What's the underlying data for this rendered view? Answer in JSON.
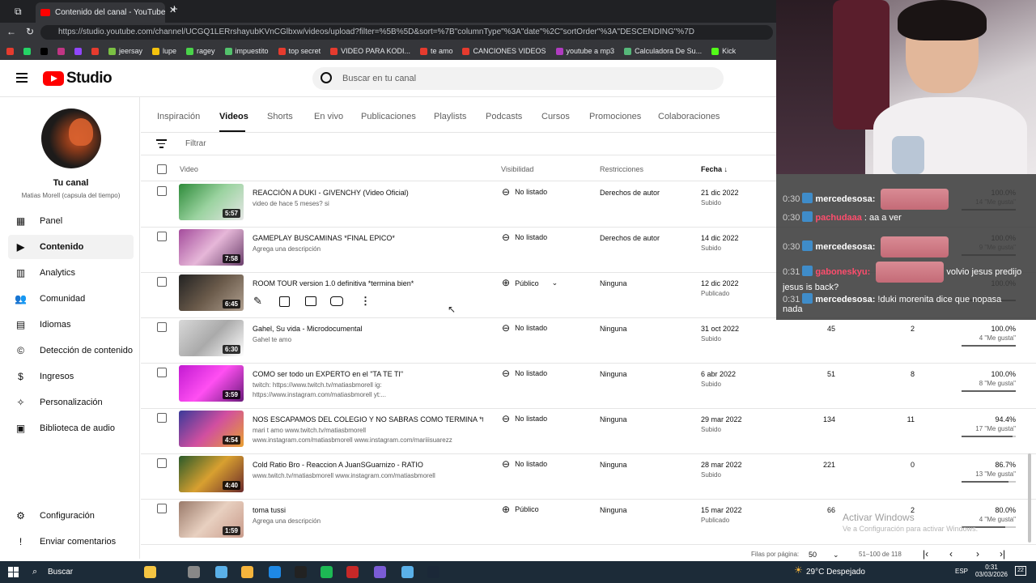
{
  "browser": {
    "tab_title": "Contenido del canal - YouTube St...",
    "url": "https://studio.youtube.com/channel/UCGQ1LERrshayubKVnCGlbxw/videos/upload?filter=%5B%5D&sort=%7B\"columnType\"%3A\"date\"%2C\"sortOrder\"%3A\"DESCENDING\"%7D",
    "bookmarks": [
      "jeersay",
      "lupe",
      "ragey",
      "impuestito",
      "top secret",
      "VIDEO PARA KODI...",
      "te amo",
      "CANCIONES VIDEOS",
      "youtube a mp3",
      "Calculadora De Su...",
      "Kick"
    ]
  },
  "header": {
    "logo_text": "Studio",
    "search_placeholder": "Buscar en tu canal"
  },
  "sidebar": {
    "channel_title": "Tu canal",
    "channel_name": "Matias Morell (capsula del tiempo)",
    "items": [
      {
        "label": "Panel",
        "icon": "dashboard-icon"
      },
      {
        "label": "Contenido",
        "icon": "content-icon"
      },
      {
        "label": "Analytics",
        "icon": "analytics-icon"
      },
      {
        "label": "Comunidad",
        "icon": "community-icon"
      },
      {
        "label": "Idiomas",
        "icon": "subtitles-icon"
      },
      {
        "label": "Detección de contenido",
        "icon": "copyright-icon"
      },
      {
        "label": "Ingresos",
        "icon": "earn-icon"
      },
      {
        "label": "Personalización",
        "icon": "magic-wand-icon"
      },
      {
        "label": "Biblioteca de audio",
        "icon": "audio-library-icon"
      }
    ],
    "bottom": [
      {
        "label": "Configuración",
        "icon": "gear-icon"
      },
      {
        "label": "Enviar comentarios",
        "icon": "feedback-icon"
      }
    ]
  },
  "content_tabs": [
    "Inspiración",
    "Videos",
    "Shorts",
    "En vivo",
    "Publicaciones",
    "Playlists",
    "Podcasts",
    "Cursos",
    "Promociones",
    "Colaboraciones"
  ],
  "filter_placeholder": "Filtrar",
  "columns": {
    "video": "Video",
    "visibility": "Visibilidad",
    "restrictions": "Restricciones",
    "date": "Fecha"
  },
  "rows": [
    {
      "title": "REACCIÓN A DUKI - GIVENCHY (Video Oficial)",
      "desc": "video de hace 5 meses? si",
      "desc2": "",
      "duration": "5:57",
      "visibility": "No listado",
      "restriction": "Derechos de autor",
      "date": "21 dic 2022",
      "status": "Subido",
      "views": "",
      "comments": "",
      "like_pct": "100.0%",
      "likes": "14 \"Me gusta\"",
      "like_frac": 1.0
    },
    {
      "title": "GAMEPLAY BUSCAMINAS *FINAL EPICO*",
      "desc": "Agrega una descripción",
      "desc2": "",
      "duration": "7:58",
      "visibility": "No listado",
      "restriction": "Derechos de autor",
      "date": "14 dic 2022",
      "status": "Subido",
      "views": "",
      "comments": "",
      "like_pct": "100.0%",
      "likes": "9 \"Me gusta\"",
      "like_frac": 1.0
    },
    {
      "title": "ROOM TOUR version 1.0 definitiva *termina bien*",
      "desc": "",
      "desc2": "",
      "duration": "6:45",
      "visibility": "Público",
      "restriction": "Ninguna",
      "date": "12 dic 2022",
      "status": "Publicado",
      "views": "",
      "comments": "",
      "like_pct": "100.0%",
      "likes": "",
      "like_frac": 1.0
    },
    {
      "title": "Gahel, Su vida - Microdocumental",
      "desc": "Gahel te amo",
      "desc2": "",
      "duration": "6:30",
      "visibility": "No listado",
      "restriction": "Ninguna",
      "date": "31 oct 2022",
      "status": "Subido",
      "views": "45",
      "comments": "2",
      "like_pct": "100.0%",
      "likes": "4 \"Me gusta\"",
      "like_frac": 1.0
    },
    {
      "title": "COMO ser todo un EXPERTO en el \"TA TE TI\"",
      "desc": "twitch: https://www.twitch.tv/matiasbmorell ig:",
      "desc2": "https://www.instagram.com/matiasbmorell yt:...",
      "duration": "3:59",
      "visibility": "No listado",
      "restriction": "Ninguna",
      "date": "6 abr 2022",
      "status": "Subido",
      "views": "51",
      "comments": "8",
      "like_pct": "100.0%",
      "likes": "8 \"Me gusta\"",
      "like_frac": 1.0
    },
    {
      "title": "NOS ESCAPAMOS DEL COLEGIO Y NO SABRAS COMO TERMINA *termi...",
      "desc": "mari t amo www.twitch.tv/matiasbmorell",
      "desc2": "www.instagram.com/matiasbmorell www.instagram.com/mariiisuarezz",
      "duration": "4:54",
      "visibility": "No listado",
      "restriction": "Ninguna",
      "date": "29 mar 2022",
      "status": "Subido",
      "views": "134",
      "comments": "11",
      "like_pct": "94.4%",
      "likes": "17 \"Me gusta\"",
      "like_frac": 0.944
    },
    {
      "title": "Cold Ratio Bro - Reaccion A JuanSGuarnizo - RATIO",
      "desc": "www.twitch.tv/matiasbmorell www.instagram.com/matiasbmorell",
      "desc2": "",
      "duration": "4:40",
      "visibility": "No listado",
      "restriction": "Ninguna",
      "date": "28 mar 2022",
      "status": "Subido",
      "views": "221",
      "comments": "0",
      "like_pct": "86.7%",
      "likes": "13 \"Me gusta\"",
      "like_frac": 0.867
    },
    {
      "title": "toma tussi",
      "desc": "Agrega una descripción",
      "desc2": "",
      "duration": "1:59",
      "visibility": "Público",
      "restriction": "Ninguna",
      "date": "15 mar 2022",
      "status": "Publicado",
      "views": "66",
      "comments": "2",
      "like_pct": "80.0%",
      "likes": "4 \"Me gusta\"",
      "like_frac": 0.8
    }
  ],
  "footer": {
    "rows_per_page_label": "Filas por página:",
    "rows_per_page": "50",
    "range": "51–100 de 118"
  },
  "watermark": {
    "line1": "Activar Windows",
    "line2": "Ve a Configuración para activar Windows."
  },
  "chat": [
    {
      "time": "0:30",
      "name": "mercedesosa:",
      "text": "",
      "emote": true
    },
    {
      "time": "0:30",
      "name": "pachudaaa",
      "text": ": aa a ver",
      "emote": false
    },
    {
      "time": "0:30",
      "name": "mercedesosa:",
      "text": "",
      "emote": true
    },
    {
      "time": "0:31",
      "name": "gaboneskyu:",
      "text": "volvio jesus predijo",
      "text2": "jesus is back?",
      "emote": true
    },
    {
      "time": "0:31",
      "name": "mercedesosa:",
      "text": "!duki morenita dice que nopasa",
      "text2": "nada",
      "emote": false
    }
  ],
  "taskbar": {
    "search_label": "Buscar",
    "weather": "29°C Despejado",
    "lang": "ESP",
    "time": "0:31",
    "date": "03/03/2026",
    "notif": "22"
  },
  "colors": {
    "accent": "#ff0000",
    "taskbar": "#1c2b38",
    "chrome": "#202124"
  }
}
